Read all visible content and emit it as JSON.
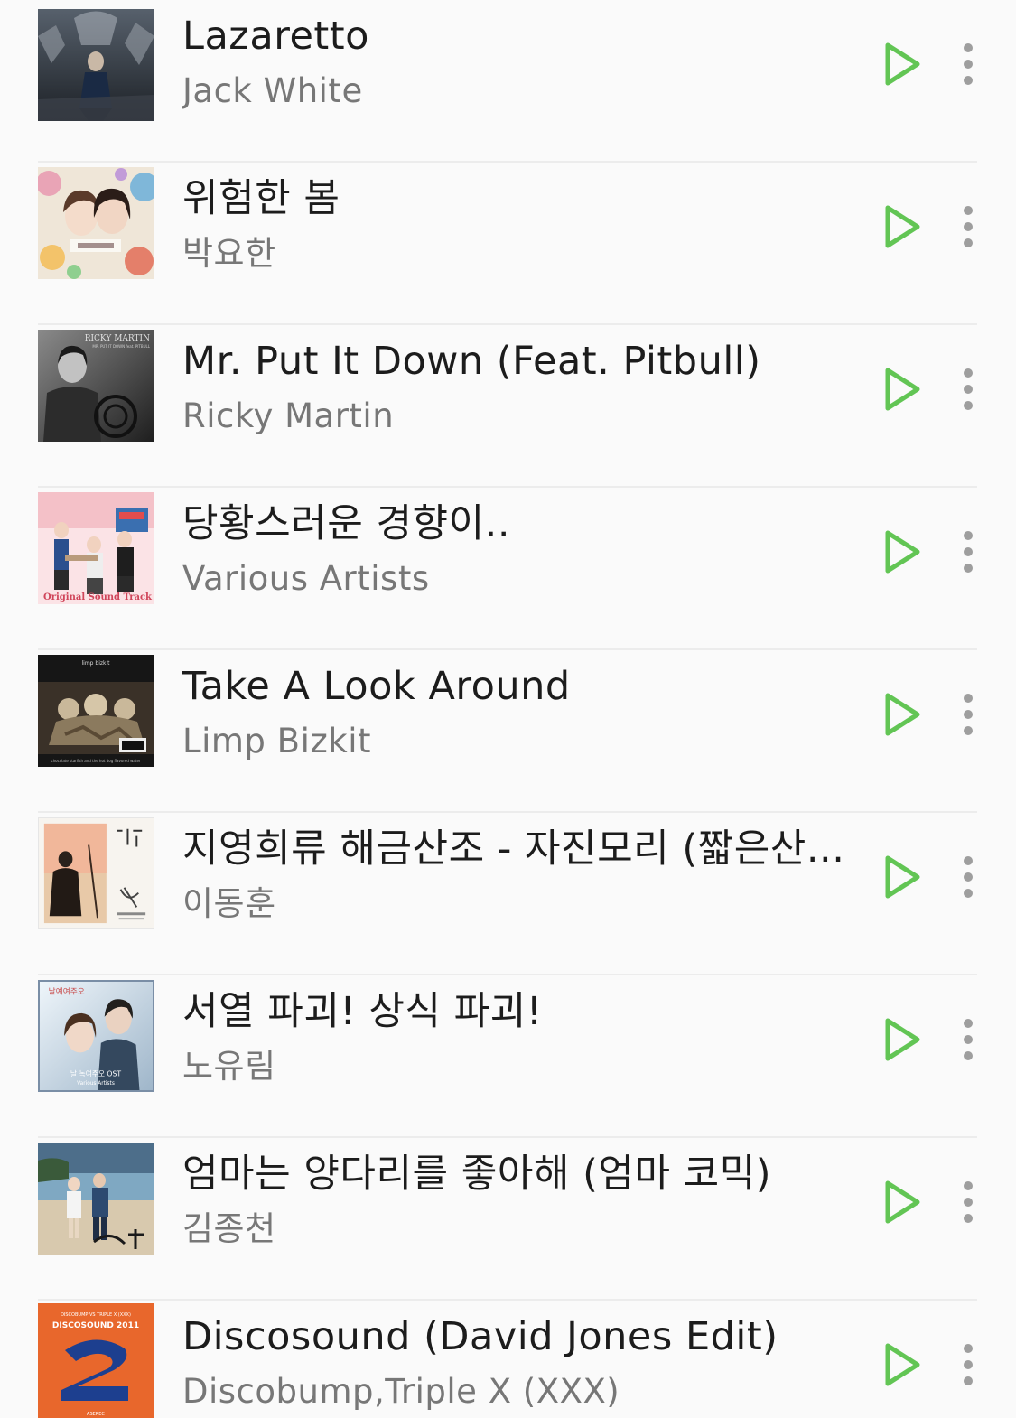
{
  "theme": {
    "accent": "#62c554",
    "title_color": "#1c1c1c",
    "artist_color": "#777777",
    "divider_color": "#ececec",
    "background": "#fafafa"
  },
  "tracks": [
    {
      "title": "Lazaretto",
      "artist": "Jack White",
      "art_icon": "album-art-lazaretto"
    },
    {
      "title": "위험한 봄",
      "artist": "박요한",
      "art_icon": "album-art-ost-collage"
    },
    {
      "title": "Mr. Put It Down (Feat. Pitbull)",
      "artist": "Ricky Martin",
      "art_icon": "album-art-ricky-martin"
    },
    {
      "title": "당황스러운 경향이..",
      "artist": "Various Artists",
      "art_icon": "album-art-original-sound-track"
    },
    {
      "title": "Take A Look Around",
      "artist": "Limp Bizkit",
      "art_icon": "album-art-limp-bizkit"
    },
    {
      "title": "지영희류 해금산조 - 자진모리 (짧은산...",
      "artist": "이동훈",
      "art_icon": "album-art-haegeum"
    },
    {
      "title": "서열 파괴! 상식 파괴!",
      "artist": "노유림",
      "art_icon": "album-art-ost-blue"
    },
    {
      "title": "엄마는 양다리를 좋아해 (엄마 코믹)",
      "artist": "김종천",
      "art_icon": "album-art-beach"
    },
    {
      "title": "Discosound (David Jones Edit)",
      "artist": "Discobump,Triple X (XXX)",
      "art_icon": "album-art-discosound"
    }
  ],
  "album_art_text": {
    "ricky": "RICKY MARTIN",
    "ricky_sub": "MR. PUT IT DOWN feat. PITBULL",
    "ost": "Original Sound Track",
    "limp": "limp bizkit",
    "limp_sub": "chocolate starfish and the hot dog flavored water",
    "ost_blue": "날 녹여주오 OST",
    "ost_blue_sub": "Various Artists",
    "disco_head": "DISCOBUMP VS TRIPLE X (XXX)",
    "disco_title": "DISCOSOUND 2011",
    "disco_foot": "ASEREC"
  },
  "icons": {
    "play": "play-icon",
    "more": "more-vertical-icon"
  }
}
